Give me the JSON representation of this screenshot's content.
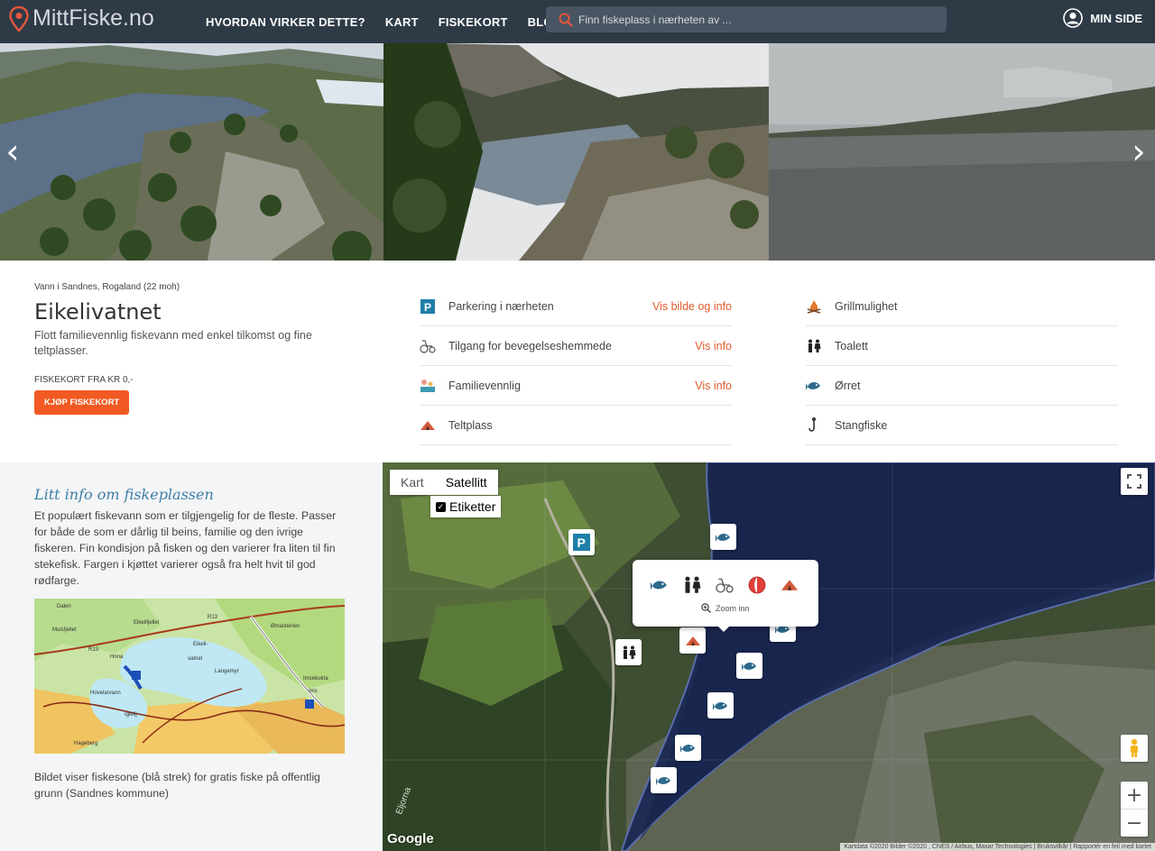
{
  "nav": {
    "logo_text": "MittFiske.no",
    "links": [
      "HVORDAN VIRKER DETTE?",
      "KART",
      "FISKEKORT",
      "BLOGG"
    ],
    "search_placeholder": "Finn fiskeplass i nærheten av ...",
    "my_page": "MIN SIDE",
    "accent_color": "#e2573a"
  },
  "hero": {
    "prev_glyph": "‹",
    "next_glyph": "›"
  },
  "place": {
    "location": "Vann i Sandnes, Rogaland (22 moh)",
    "name": "Eikelivatnet",
    "description": "Flott familievennlig fiskevann med enkel tilkomst og fine teltplasser.",
    "price": "FISKEKORT FRA KR 0,-",
    "buy_button": "KJØP FISKEKORT"
  },
  "features_left": [
    {
      "label": "Parkering i nærheten",
      "link": "Vis bilde og info",
      "icon": "parking-icon"
    },
    {
      "label": "Tilgang for bevegelseshemmede",
      "link": "Vis info",
      "icon": "wheelchair-icon"
    },
    {
      "label": "Familievennlig",
      "link": "Vis info",
      "icon": "family-icon"
    },
    {
      "label": "Teltplass",
      "link": "",
      "icon": "tent-icon"
    }
  ],
  "features_right": [
    {
      "label": "Grillmulighet",
      "icon": "campfire-icon"
    },
    {
      "label": "Toalett",
      "icon": "toilet-icon"
    },
    {
      "label": "Ørret",
      "icon": "fish-icon"
    },
    {
      "label": "Stangfiske",
      "icon": "hook-icon"
    }
  ],
  "about": {
    "heading": "Litt info om fiskeplassen",
    "text": "Et populært fiskevann som er tilgjengelig for de fleste. Passer for både de som er dårlig til beins, familie og den ivrige fiskeren. Fin kondisjon på fisken og den varierer fra liten til fin stekefisk. Fargen i kjøttet varierer også fra helt hvit til god rødfarge.",
    "caption": "Bildet viser fiskesone (blå strek) for gratis fiske på offentlig grunn (Sandnes kommune)",
    "mini_map_labels": [
      "Dalen",
      "Mulsfjellet",
      "Eikelifjellet",
      "R13",
      "Ømasteinen",
      "Eikeli-",
      "vatnet",
      "Langemyr",
      "Imsebukta",
      "Hovelarvann",
      "Iglelij",
      "Hageberg",
      "R13",
      "Hona",
      "Ims"
    ]
  },
  "map": {
    "type_map": "Kart",
    "type_satellite": "Satellitt",
    "labels_toggle": "Etiketter",
    "labels_checked": "✓",
    "popup_zoom": "Zoom inn",
    "zoom_in": "+",
    "zoom_out": "−",
    "google": "Google",
    "water_label": "Eljorna",
    "attribution": "Kartdata ©2020 Bilder ©2020 , CNES / Airbus, Maxar Technologies | Bruksvilkår | Rapportér en feil med kartet"
  },
  "colors": {
    "nav_bg": "#2f3a47",
    "link": "#e05a2b",
    "buy_button": "#f15a22",
    "heading_blue": "#3d7ea6"
  }
}
